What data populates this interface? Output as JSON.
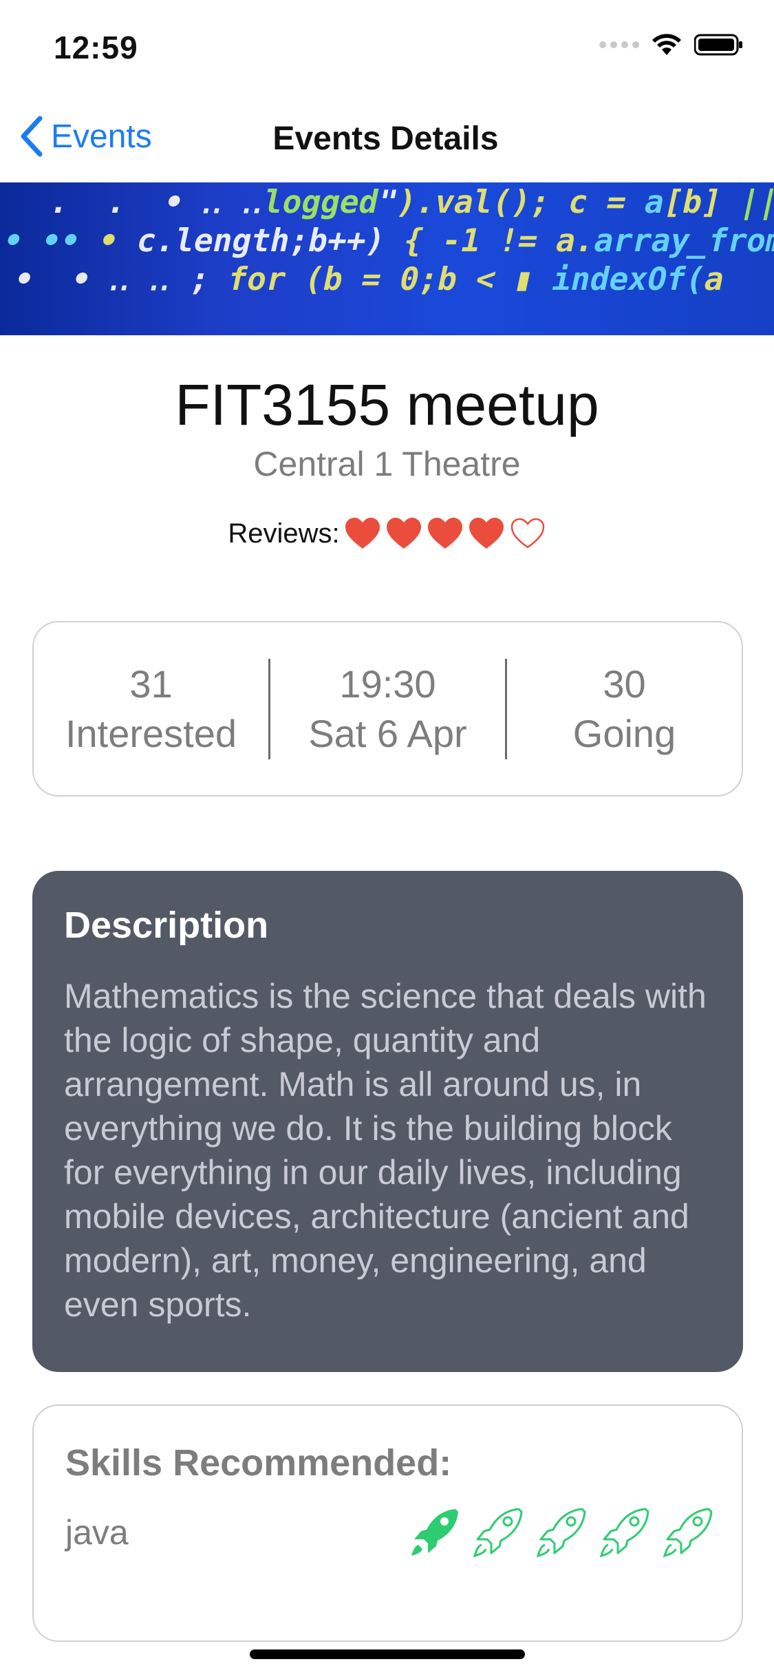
{
  "status_bar": {
    "time": "12:59",
    "icons": [
      "signal-dots-icon",
      "wifi-icon",
      "battery-icon"
    ]
  },
  "nav": {
    "back_label": "Events",
    "title": "Events Details",
    "back_icon": "chevron-left-icon"
  },
  "event": {
    "title": "FIT3155 meetup",
    "venue": "Central 1 Theatre",
    "reviews_label": "Reviews:",
    "rating": 4,
    "rating_max": 5
  },
  "stats": {
    "interested_count": "31",
    "interested_label": "Interested",
    "time": "19:30",
    "date": "Sat 6 Apr",
    "going_count": "30",
    "going_label": "Going"
  },
  "description": {
    "heading": "Description",
    "body": "Mathematics is the science that deals with the logic of shape, quantity and arrangement. Math is all around us, in everything we do. It is the building block for everything in our daily lives, including mobile devices, architecture (ancient and modern), art, money, engineering, and even sports."
  },
  "skills": {
    "heading": "Skills Recommended:",
    "items": [
      {
        "name": "java",
        "level": 1,
        "max": 5
      }
    ]
  },
  "colors": {
    "accent": "#1a7cf5",
    "heart": "#ea4d3c",
    "rocket": "#2ecc71",
    "description_bg": "#545966"
  }
}
